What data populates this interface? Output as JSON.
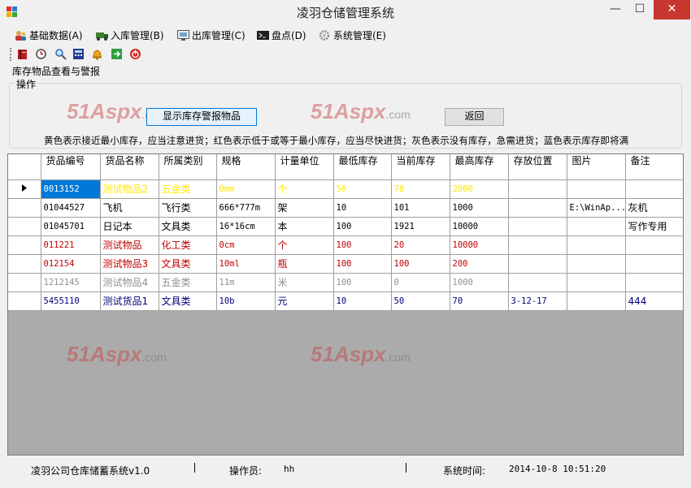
{
  "window": {
    "title": "凌羽仓储管理系统",
    "minimize": "—",
    "maximize": "☐",
    "close": "✕"
  },
  "menu": [
    {
      "label": "基础数据(A)",
      "icon": "users-icon"
    },
    {
      "label": "入库管理(B)",
      "icon": "truck-in-icon"
    },
    {
      "label": "出库管理(C)",
      "icon": "monitor-icon"
    },
    {
      "label": "盘点(D)",
      "icon": "terminal-icon"
    },
    {
      "label": "系统管理(E)",
      "icon": "gear-icon"
    }
  ],
  "toolbar": [
    "book-icon",
    "refresh-icon",
    "search-icon",
    "calculator-icon",
    "bell-icon",
    "exit-icon",
    "power-icon"
  ],
  "section": {
    "title": "库存物品查看与警报",
    "group": "操作"
  },
  "buttons": {
    "show_alert": "显示库存警报物品",
    "back": "返回"
  },
  "legend_note": "黄色表示接近最小库存，应当注意进货；红色表示低于或等于最小库存，应当尽快进货；灰色表示没有库存，急需进货；蓝色表示库存即将满",
  "watermark": {
    "main": "51Aspx",
    "suffix": ".com"
  },
  "table": {
    "headers": [
      "货品编号",
      "货品名称",
      "所属类别",
      "规格",
      "计量单位",
      "最低库存",
      "当前库存",
      "最高库存",
      "存放位置",
      "图片",
      "备注"
    ],
    "rows": [
      {
        "color": "#ffe800",
        "selected": true,
        "cells": [
          "0013152",
          "测试物品2",
          "五金类",
          "0mm",
          "个",
          "50",
          "70",
          "2000",
          "",
          "",
          ""
        ]
      },
      {
        "color": "#000000",
        "cells": [
          "01044527",
          "飞机",
          "飞行类",
          "666*777m",
          "架",
          "10",
          "101",
          "1000",
          "",
          "E:\\WinAp...",
          "灰机"
        ]
      },
      {
        "color": "#000000",
        "cells": [
          "01045701",
          "日记本",
          "文具类",
          "16*16cm",
          "本",
          "100",
          "1921",
          "10000",
          "",
          "",
          "写作专用"
        ]
      },
      {
        "color": "#c00000",
        "cells": [
          "011221",
          "测试物品",
          "化工类",
          "0cm",
          "个",
          "100",
          "20",
          "10000",
          "",
          "",
          ""
        ]
      },
      {
        "color": "#c00000",
        "cells": [
          "012154",
          "测试物品3",
          "文具类",
          "10ml",
          "瓶",
          "100",
          "100",
          "200",
          "",
          "",
          ""
        ]
      },
      {
        "color": "#909090",
        "cells": [
          "1212145",
          "测试物品4",
          "五金类",
          "11m",
          "米",
          "100",
          "0",
          "1000",
          "",
          "",
          ""
        ]
      },
      {
        "color": "#00007a",
        "cells": [
          "5455110",
          "测试货品1",
          "文具类",
          "10b",
          "元",
          "10",
          "50",
          "70",
          "3-12-17",
          "",
          "444"
        ]
      }
    ]
  },
  "status": {
    "app": "凌羽公司仓库储蓄系统v1.0",
    "operator_label": "操作员:",
    "operator": "hh",
    "time_label": "系统时间:",
    "time": "2014-10-8 10:51:20"
  }
}
